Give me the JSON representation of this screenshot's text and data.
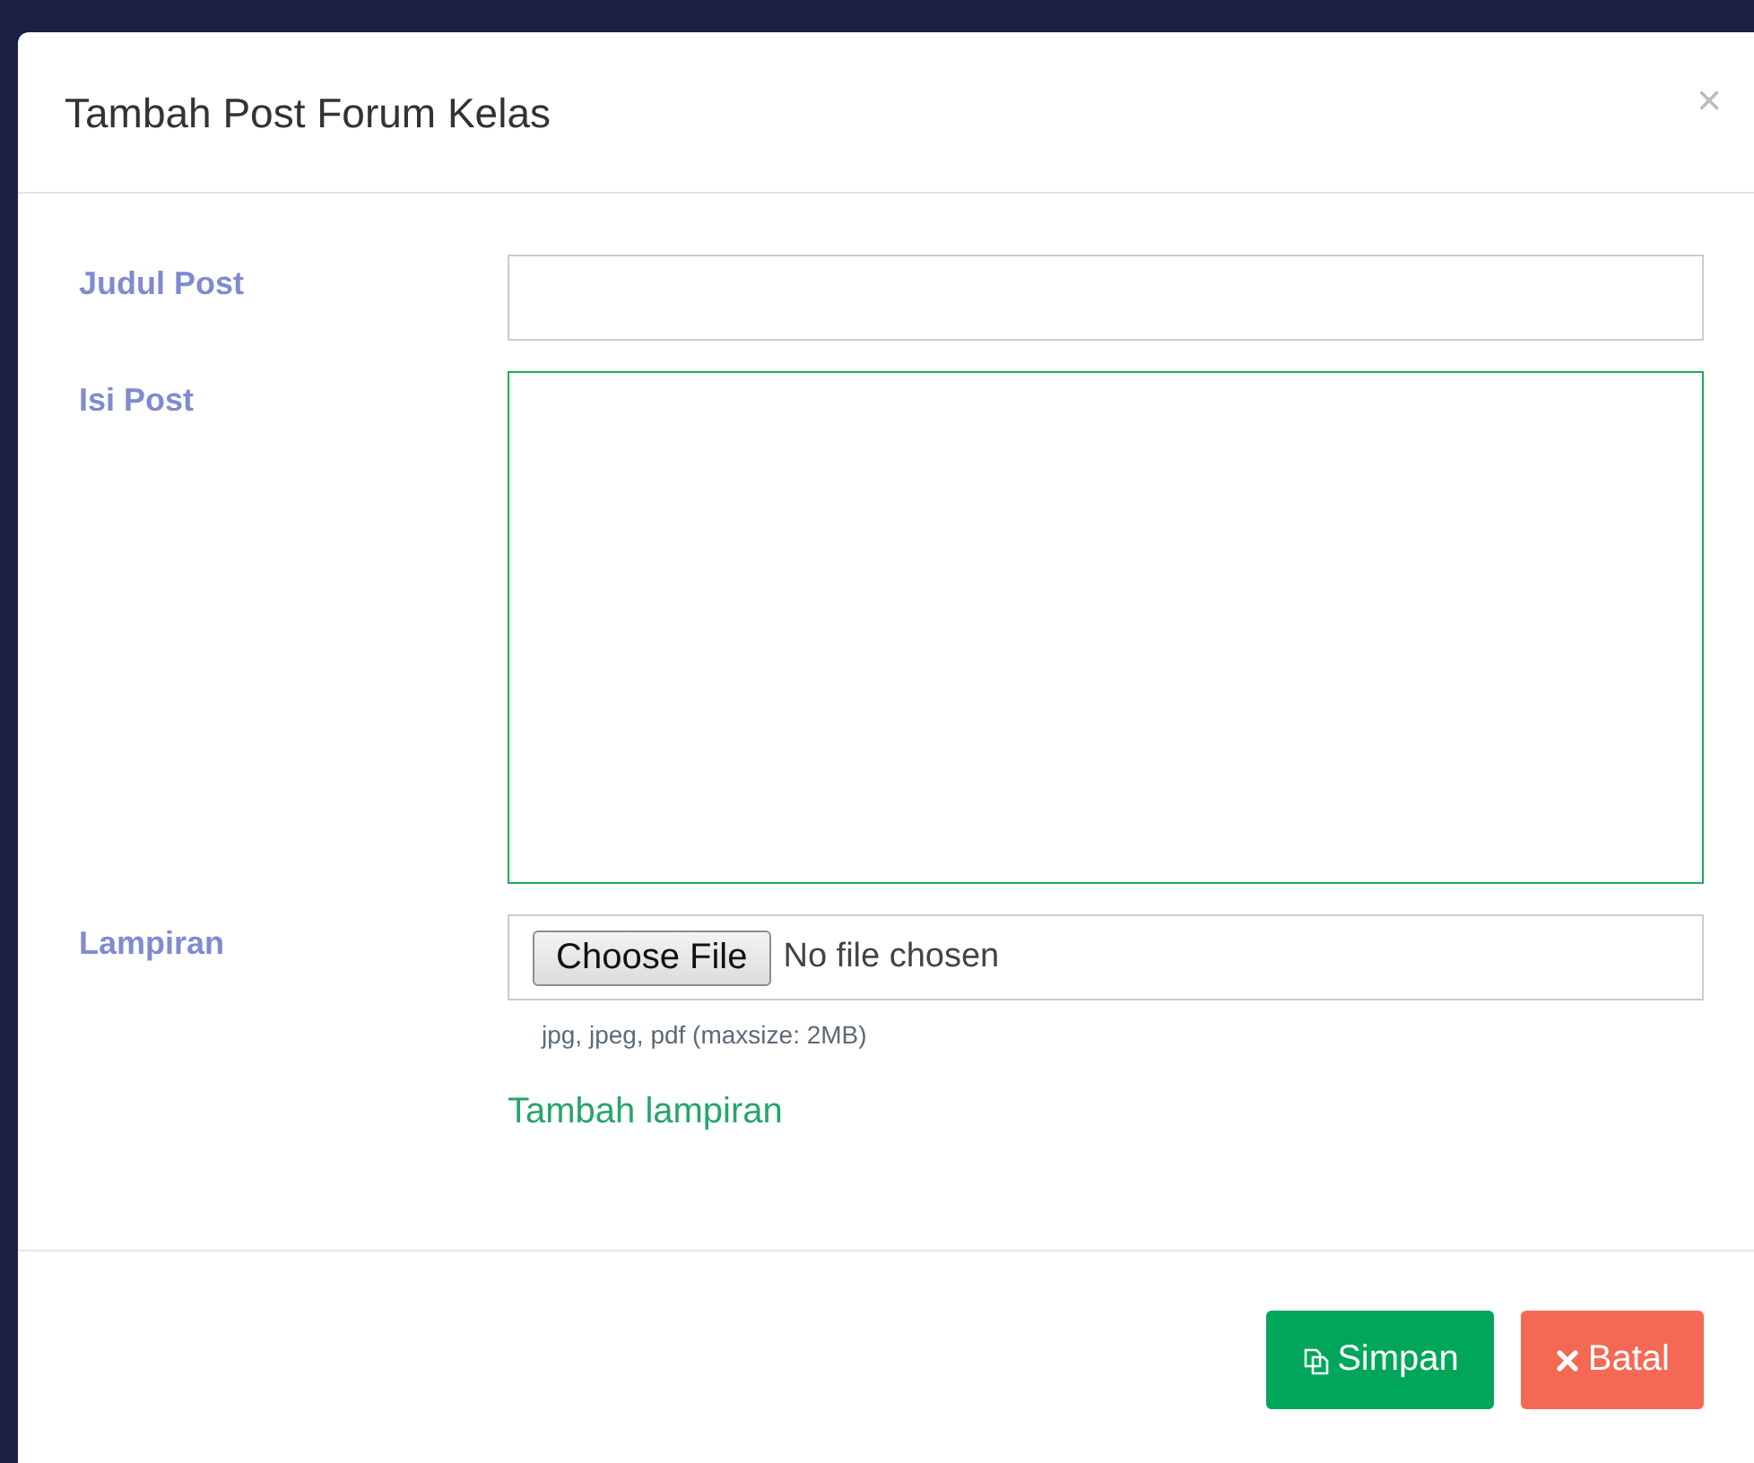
{
  "dialog": {
    "title": "Tambah Post Forum Kelas",
    "close": "×"
  },
  "fields": [
    {
      "kind": "text",
      "label": "Judul Post",
      "focused": false
    },
    {
      "kind": "textarea",
      "label": "Isi Post",
      "focused": true
    },
    {
      "kind": "file",
      "label": "Lampiran",
      "focused": false,
      "button": "Choose File",
      "status": "No file chosen",
      "hint": "jpg, jpeg, pdf (maxsize: 2MB)",
      "link": "Tambah lampiran"
    }
  ],
  "buttons": [
    {
      "kind": "save",
      "label": "Simpan"
    },
    {
      "kind": "cancel",
      "label": "Batal"
    }
  ]
}
